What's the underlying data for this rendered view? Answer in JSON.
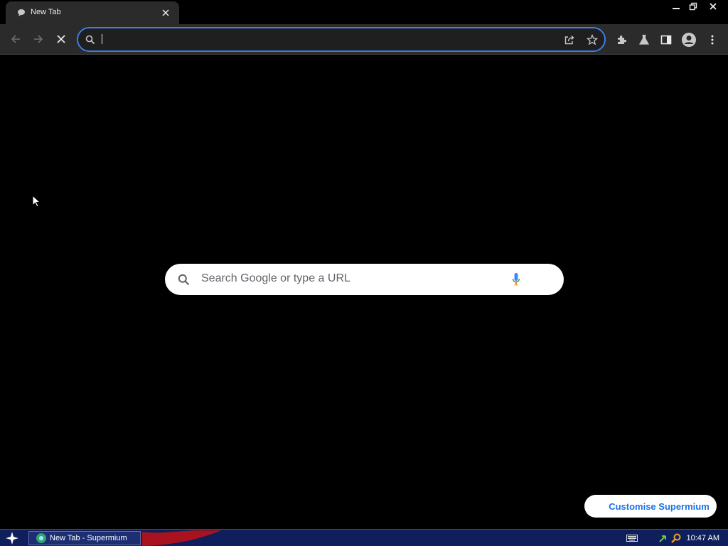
{
  "browser": {
    "tab": {
      "title": "New Tab",
      "favicon": "chat-bubble-icon"
    },
    "window_controls": [
      "minimize-icon",
      "restore-icon",
      "close-icon"
    ]
  },
  "toolbar": {
    "omnibox": {
      "value": "",
      "placeholder": ""
    },
    "icons": [
      "back-icon",
      "forward-icon",
      "stop-loading-icon",
      "share-icon",
      "bookmark-star-icon",
      "extensions-icon",
      "labs-flask-icon",
      "side-panel-icon",
      "profile-avatar-icon",
      "more-menu-icon"
    ]
  },
  "ntp": {
    "search_placeholder": "Search Google or type a URL",
    "customise_label": "Customise Supermium"
  },
  "taskbar": {
    "task_label": "New Tab - Supermium",
    "clock": "10:47 AM"
  },
  "colors": {
    "accent": "#3b7ee6",
    "link": "#1a73e8",
    "taskbar": "#0e1f5c",
    "toolbar": "#2b2b2b"
  }
}
